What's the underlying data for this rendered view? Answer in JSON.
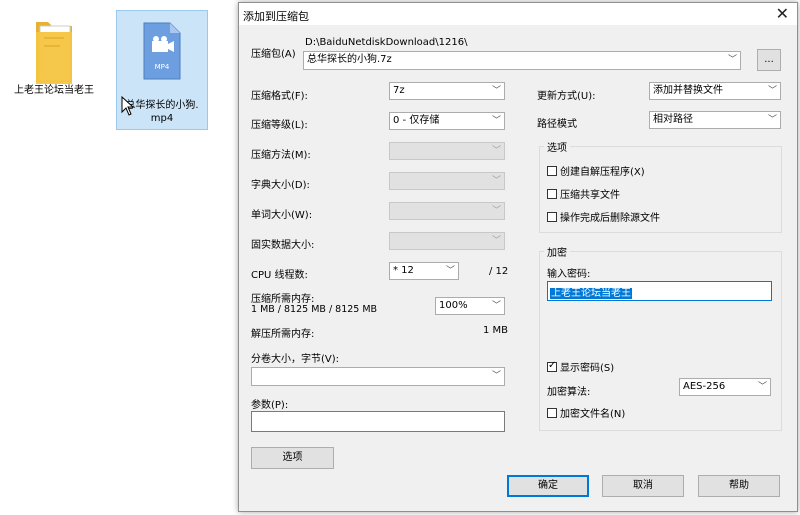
{
  "desktop": {
    "folder_label": "上老王论坛当老王",
    "video_label": "总华探长的小狗.mp4",
    "video_badge": "MP4"
  },
  "dialog": {
    "title": "添加到压缩包",
    "archive_label": "压缩包(A)",
    "archive_path": "D:\\BaiduNetdiskDownload\\1216\\",
    "archive_name": "总华探长的小狗.7z",
    "browse_label": "...",
    "format_label": "压缩格式(F):",
    "format_value": "7z",
    "level_label": "压缩等级(L):",
    "level_value": "0 - 仅存储",
    "method_label": "压缩方法(M):",
    "dict_label": "字典大小(D):",
    "word_label": "单词大小(W):",
    "solid_label": "固实数据大小:",
    "cpu_label": "CPU 线程数:",
    "cpu_value": "* 12",
    "cpu_total": "/ 12",
    "mem_compress_label": "压缩所需内存:",
    "mem_compress_value": "1 MB / 8125 MB / 8125 MB",
    "mem_percent": "100%",
    "mem_decompress_label": "解压所需内存:",
    "mem_decompress_value": "1 MB",
    "split_label": "分卷大小，字节(V):",
    "params_label": "参数(P):",
    "options_button": "选项",
    "update_label": "更新方式(U):",
    "update_value": "添加并替换文件",
    "path_label": "路径模式",
    "path_value": "相对路径",
    "options_group": "选项",
    "opt_sfx": "创建自解压程序(X)",
    "opt_shared": "压缩共享文件",
    "opt_delete": "操作完成后删除源文件",
    "encrypt_group": "加密",
    "pw_label": "输入密码:",
    "pw_value": "上老王论坛当老王",
    "show_pw": "显示密码(S)",
    "algo_label": "加密算法:",
    "algo_value": "AES-256",
    "encrypt_names": "加密文件名(N)",
    "ok": "确定",
    "cancel": "取消",
    "help": "帮助"
  },
  "colors": {
    "accent": "#0078d7",
    "folder": "#f4c542",
    "video_icon": "#5b8fd6"
  }
}
